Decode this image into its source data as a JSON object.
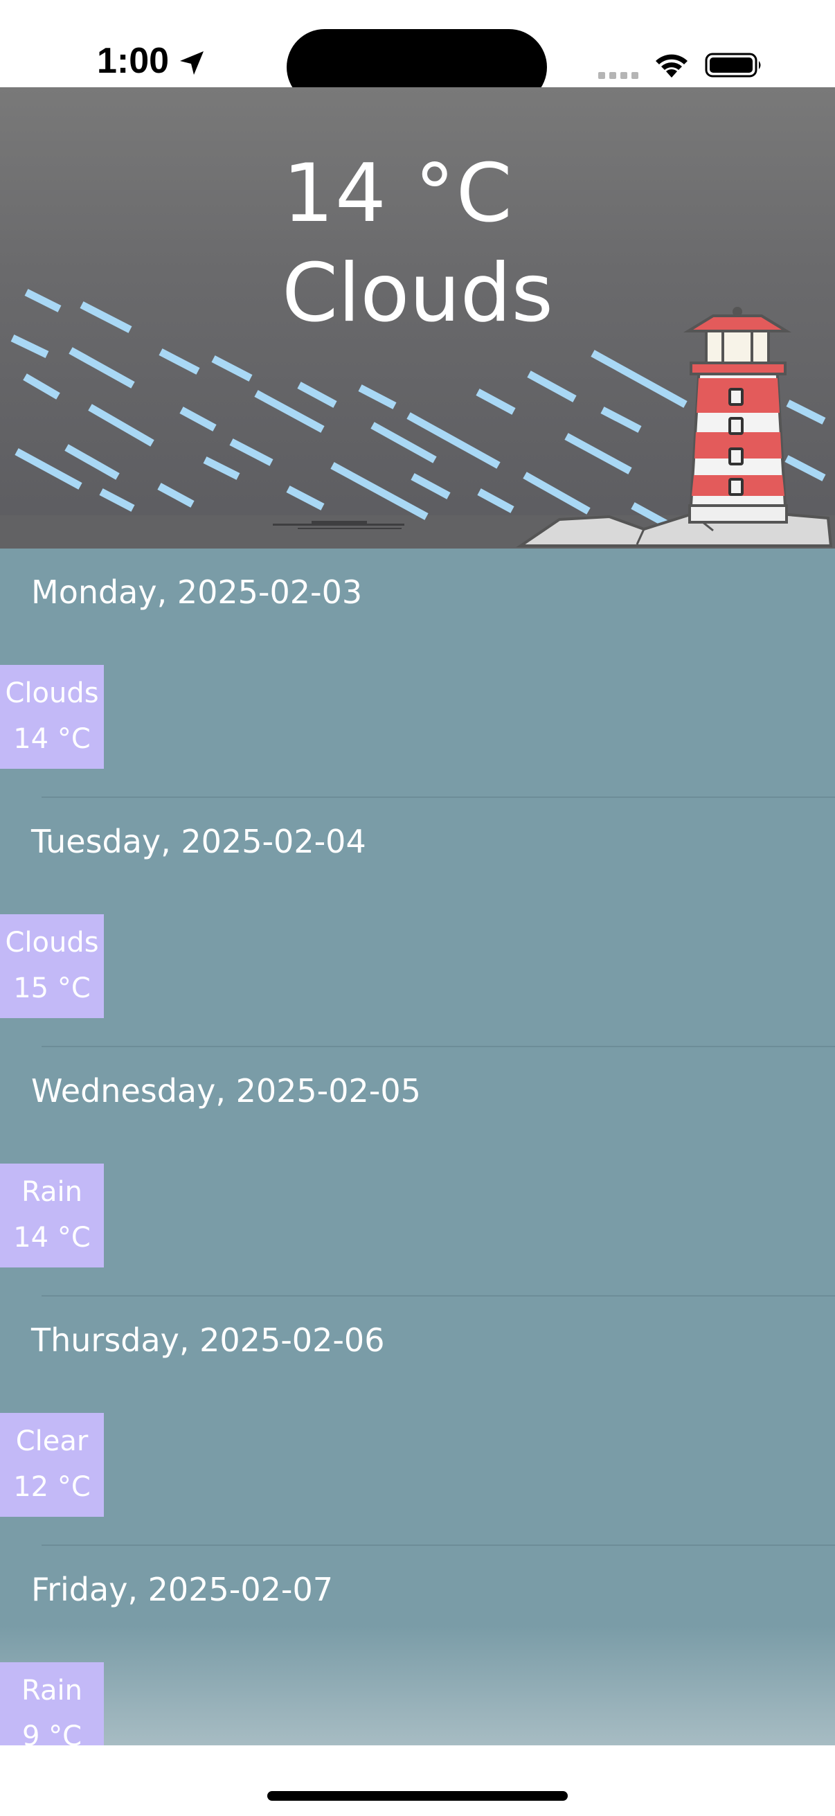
{
  "status_bar": {
    "time": "1:00"
  },
  "hero": {
    "temperature": "14 °C",
    "condition": "Clouds"
  },
  "forecast": [
    {
      "date": "Monday, 2025-02-03",
      "condition": "Clouds",
      "temperature": "14 °C"
    },
    {
      "date": "Tuesday, 2025-02-04",
      "condition": "Clouds",
      "temperature": "15 °C"
    },
    {
      "date": "Wednesday, 2025-02-05",
      "condition": "Rain",
      "temperature": "14 °C"
    },
    {
      "date": "Thursday, 2025-02-06",
      "condition": "Clear",
      "temperature": "12 °C"
    },
    {
      "date": "Friday, 2025-02-07",
      "condition": "Rain",
      "temperature": "9 °C"
    }
  ],
  "colors": {
    "list_background": "#7a9ca7",
    "card_background": "#c3b9f7",
    "hero_background": "#6a6a6c",
    "rain_streak": "#a9d8f5",
    "lighthouse_red": "#e35b5b"
  },
  "icons": [
    "location-arrow-icon",
    "cellular-icon",
    "wifi-icon",
    "battery-icon",
    "lighthouse-icon"
  ]
}
